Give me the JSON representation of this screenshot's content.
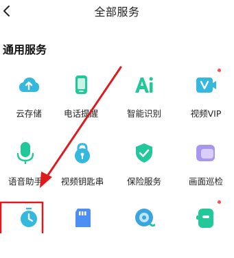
{
  "header": {
    "title": "全部服务",
    "back_icon": "chevron-left-icon"
  },
  "section": {
    "title": "通用服务"
  },
  "accent_color": "#21c79a",
  "services": [
    {
      "label": "云存储",
      "icon": "cloud-upload-icon",
      "badge": false
    },
    {
      "label": "电话提醒",
      "icon": "phone-icon",
      "badge": false
    },
    {
      "label": "智能识别",
      "icon": "ai-icon",
      "badge": false
    },
    {
      "label": "视频VIP",
      "icon": "video-vip-icon",
      "badge": true
    },
    {
      "label": "语音助手",
      "icon": "microphone-icon",
      "badge": false
    },
    {
      "label": "视频钥匙串",
      "icon": "keychain-lock-icon",
      "badge": false
    },
    {
      "label": "保险服务",
      "icon": "shield-check-icon",
      "badge": false
    },
    {
      "label": "画面巡检",
      "icon": "inspection-icon",
      "badge": false
    },
    {
      "label": "",
      "icon": "clock-icon",
      "badge": false
    },
    {
      "label": "",
      "icon": "sd-card-icon",
      "badge": false
    },
    {
      "label": "",
      "icon": "camera-icon",
      "badge": false
    },
    {
      "label": "",
      "icon": "plugin-icon",
      "badge": true
    }
  ]
}
